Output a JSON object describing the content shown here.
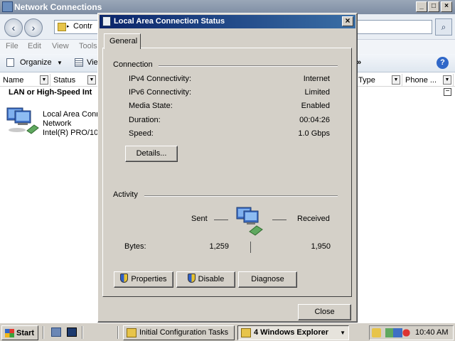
{
  "explorer": {
    "title": "Network Connections",
    "address": "Contr",
    "menu": [
      "File",
      "Edit",
      "View",
      "Tools"
    ],
    "toolbar": {
      "organize": "Organize",
      "views": "Vie"
    },
    "columns": [
      "Name",
      "Status",
      "Type",
      "Phone ..."
    ],
    "group_header": "LAN or High-Speed Int",
    "connection": {
      "name": "Local Area Conn",
      "network": "Network",
      "adapter": "Intel(R) PRO/10"
    }
  },
  "dialog": {
    "title": "Local Area Connection Status",
    "tab": "General",
    "connection": {
      "title": "Connection",
      "rows": [
        {
          "label": "IPv4 Connectivity:",
          "value": "Internet"
        },
        {
          "label": "IPv6 Connectivity:",
          "value": "Limited"
        },
        {
          "label": "Media State:",
          "value": "Enabled"
        },
        {
          "label": "Duration:",
          "value": "00:04:26"
        },
        {
          "label": "Speed:",
          "value": "1.0 Gbps"
        }
      ],
      "details_button": "Details..."
    },
    "activity": {
      "title": "Activity",
      "sent_label": "Sent",
      "received_label": "Received",
      "bytes_label": "Bytes:",
      "bytes_sent": "1,259",
      "bytes_received": "1,950"
    },
    "buttons": {
      "properties": "Properties",
      "disable": "Disable",
      "diagnose": "Diagnose",
      "close": "Close"
    }
  },
  "taskbar": {
    "start": "Start",
    "tasks": [
      "Initial Configuration Tasks",
      "4 Windows Explorer"
    ],
    "clock": "10:40 AM"
  }
}
